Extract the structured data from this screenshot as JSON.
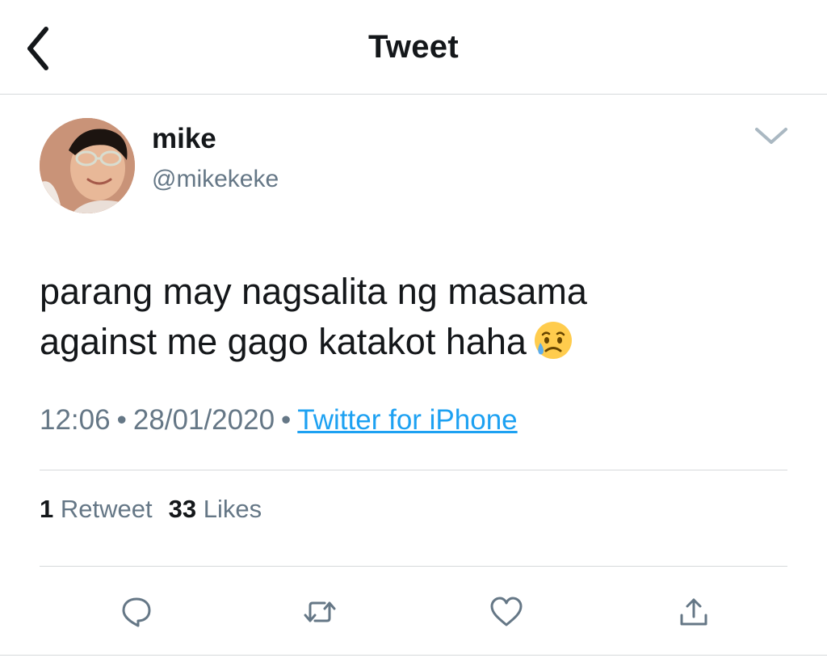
{
  "header": {
    "title": "Tweet",
    "back_icon": "chevron-left-icon"
  },
  "author": {
    "display_name": "mike",
    "handle": "@mikekeke",
    "avatar": "profile-photo",
    "menu_icon": "chevron-down-icon"
  },
  "tweet": {
    "text_line_1": "parang may nagsalita ng masama",
    "text_line_2": "against me gago katakot haha",
    "emoji": "sad-but-relieved-face-emoji"
  },
  "meta": {
    "time": "12:06",
    "separator": "•",
    "date": "28/01/2020",
    "source": "Twitter for iPhone"
  },
  "stats": {
    "retweet_count": "1",
    "retweet_label": "Retweet",
    "like_count": "33",
    "like_label": "Likes"
  },
  "actions": {
    "reply_icon": "reply-icon",
    "retweet_icon": "retweet-icon",
    "like_icon": "heart-icon",
    "share_icon": "share-icon"
  },
  "colors": {
    "link": "#1da1f2",
    "secondary_text": "#657786",
    "primary_text": "#14171a",
    "divider": "#d6d9db",
    "icon": "#657786"
  }
}
